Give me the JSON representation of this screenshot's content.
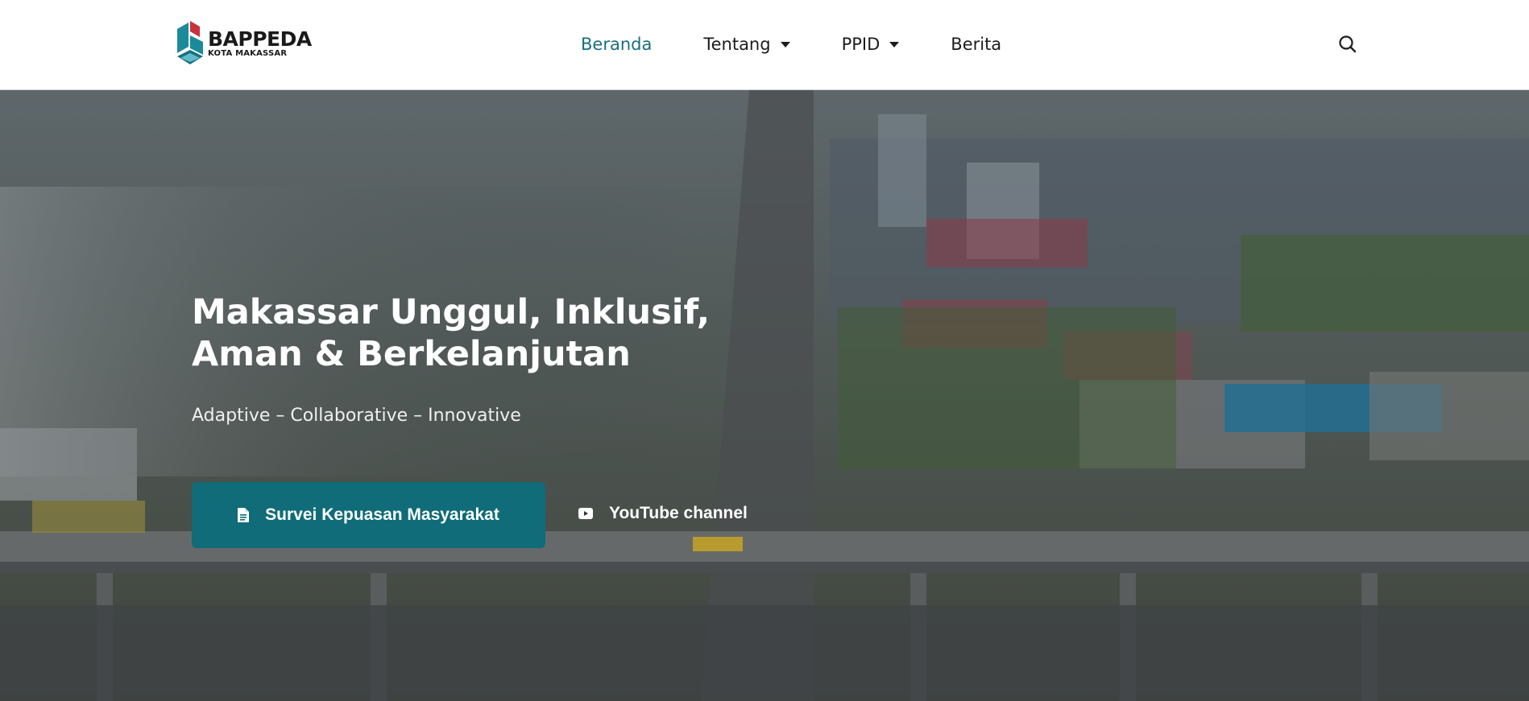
{
  "brand": {
    "name": "BAPPEDA",
    "subtitle": "KOTA MAKASSAR",
    "colors": {
      "teal": "#1b8a9a",
      "dark_teal": "#17707f",
      "red": "#c8323a"
    }
  },
  "nav": {
    "items": [
      {
        "label": "Beranda",
        "active": true,
        "has_dropdown": false
      },
      {
        "label": "Tentang",
        "active": false,
        "has_dropdown": true
      },
      {
        "label": "PPID",
        "active": false,
        "has_dropdown": true
      },
      {
        "label": "Berita",
        "active": false,
        "has_dropdown": false
      }
    ],
    "search_icon": "search-icon"
  },
  "hero": {
    "title_line1": "Makassar Unggul, Inklusif,",
    "title_line2": "Aman & Berkelanjutan",
    "subtitle": "Adaptive – Collaborative – Innovative",
    "primary_button": {
      "label": "Survei Kepuasan Masyarakat",
      "icon": "document-icon",
      "color": "#0f6c78"
    },
    "secondary_button": {
      "label": "YouTube channel",
      "icon": "youtube-icon"
    },
    "background": "aerial city photo"
  }
}
